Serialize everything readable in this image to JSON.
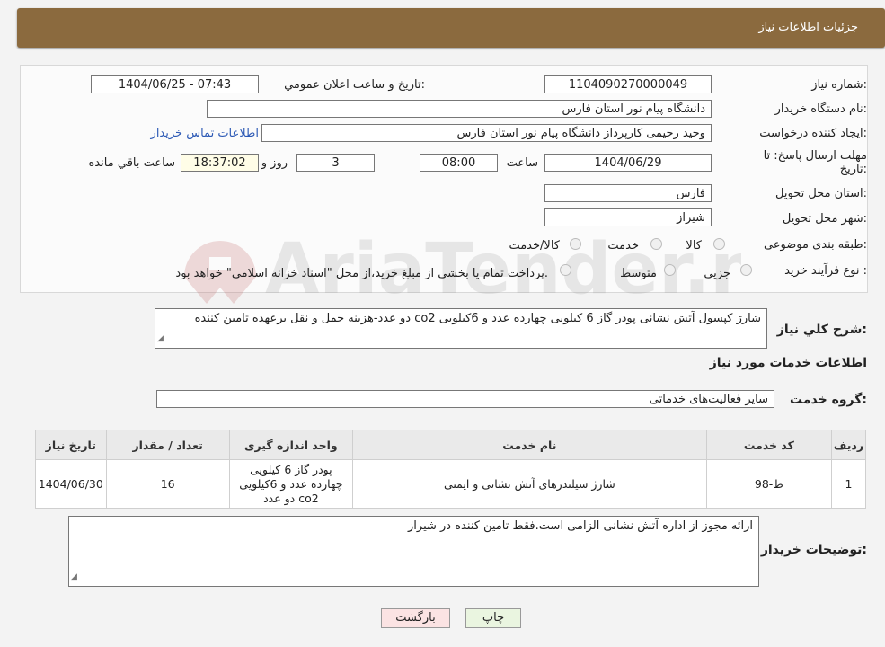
{
  "header": {
    "title": "جزئیات اطلاعات نیاز"
  },
  "form": {
    "need_number_label": "شماره نیاز:",
    "need_number": "1104090270000049",
    "announce_label": "تاریخ و ساعت اعلان عمومي:",
    "announce_value": "1404/06/25 - 07:43",
    "buyer_org_label": "نام دستگاه خریدار:",
    "buyer_org": "دانشگاه پیام نور استان فارس",
    "creator_label": "ایجاد کننده درخواست:",
    "creator": "وحید رحیمی کارپرداز دانشگاه پیام نور استان فارس",
    "contact_link": "اطلاعات تماس خریدار",
    "deadline_label_1": "مهلت ارسال پاسخ: تا",
    "deadline_label_2": "تاریخ:",
    "deadline_date": "1404/06/29",
    "time_label": "ساعت",
    "deadline_time": "08:00",
    "days_value": "3",
    "days_label": "روز و",
    "remaining_time": "18:37:02",
    "remaining_label": "ساعت باقي مانده",
    "province_label": "استان محل تحویل:",
    "province": "فارس",
    "city_label": "شهر محل تحویل:",
    "city": "شیراز",
    "category_label": "طبقه بندی موضوعی:",
    "category_options": [
      "کالا",
      "خدمت",
      "کالا/خدمت"
    ],
    "process_label": "نوع فرآیند خرید :",
    "process_options": [
      "جزیی",
      "متوسط"
    ],
    "process_note": "پرداخت تمام یا بخشی از مبلغ خرید،از محل \"اسناد خزانه اسلامی\" خواهد بود."
  },
  "description": {
    "label": "شرح کلي نياز:",
    "text": "شارژ کپسول آتش نشانی پودر گاز 6 کیلویی چهارده عدد و 6کیلویی co2    دو عدد-هزینه حمل و نقل برعهده تامین کننده"
  },
  "services": {
    "section_title": "اطلاعات خدمات مورد نیاز",
    "group_label": "گروه خدمت:",
    "group_value": "سایر فعالیت‌های خدماتی",
    "table": {
      "headers": [
        "ردیف",
        "کد خدمت",
        "نام خدمت",
        "واحد اندازه گیری",
        "تعداد / مقدار",
        "تاریخ نیاز"
      ],
      "rows": [
        {
          "row": "1",
          "code": "ط-98",
          "name": "شارژ سیلندرهای آتش نشانی و ایمنی",
          "unit": "پودر گاز 6 کیلویی چهارده عدد و 6کیلویی co2 دو عدد",
          "qty": "16",
          "date": "1404/06/30"
        }
      ]
    }
  },
  "buyer_notes": {
    "label": "توضیحات خریدار:",
    "text": "ارائه مجوز از اداره آتش نشانی الزامی است.فقط تامین کننده در شیراز"
  },
  "buttons": {
    "print": "چاپ",
    "back": "بازگشت"
  },
  "watermark": {
    "text": "AriaTender.neT"
  },
  "colors": {
    "header_bg": "#8b6a3e",
    "link": "#2c59b5",
    "print_btn": "#eaf5e0",
    "back_btn": "#fbe3e3"
  }
}
